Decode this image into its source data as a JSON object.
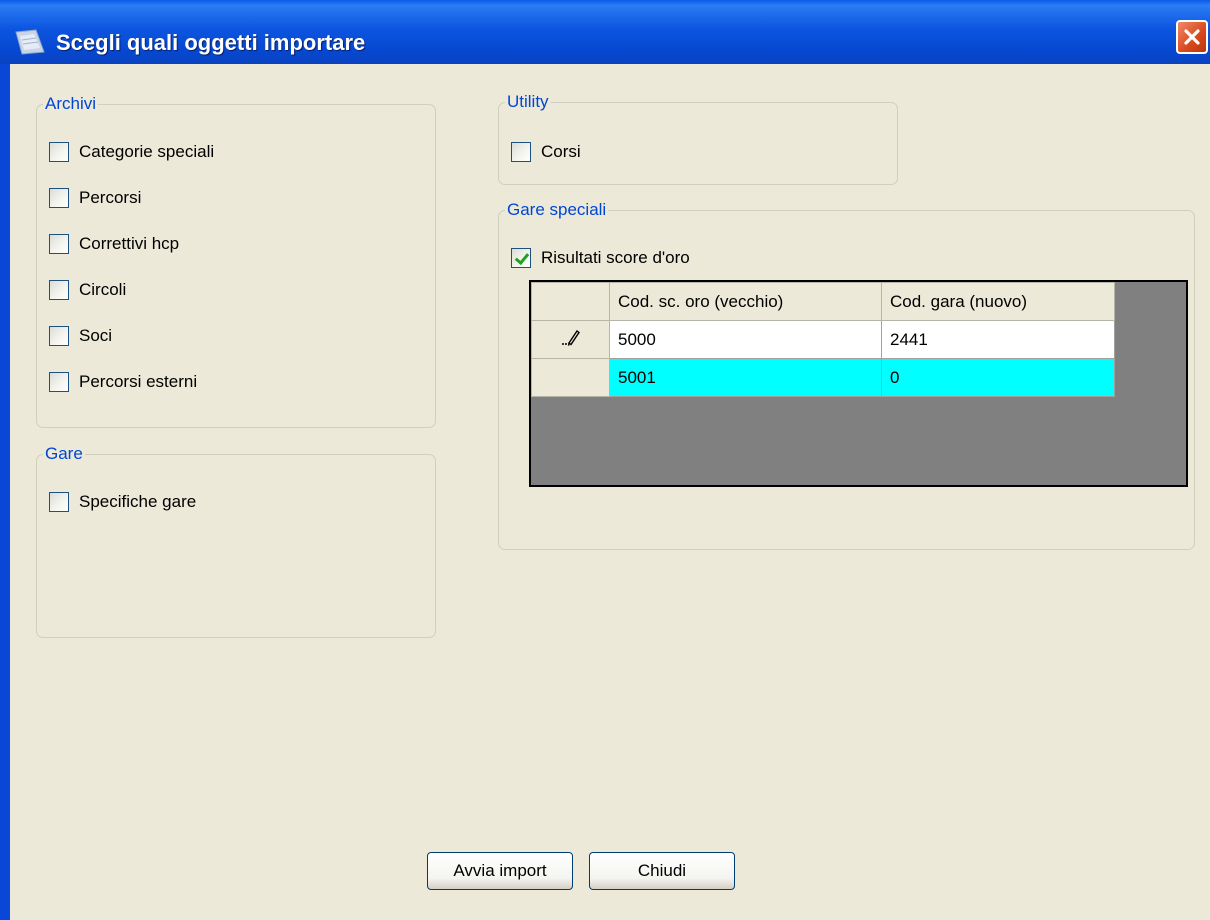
{
  "window": {
    "title": "Scegli quali oggetti importare"
  },
  "archivi": {
    "legend": "Archivi",
    "items": [
      {
        "label": "Categorie speciali",
        "checked": false
      },
      {
        "label": "Percorsi",
        "checked": false
      },
      {
        "label": "Correttivi hcp",
        "checked": false
      },
      {
        "label": "Circoli",
        "checked": false
      },
      {
        "label": "Soci",
        "checked": false
      },
      {
        "label": "Percorsi esterni",
        "checked": false
      }
    ]
  },
  "gare": {
    "legend": "Gare",
    "items": [
      {
        "label": "Specifiche gare",
        "checked": false
      }
    ]
  },
  "utility": {
    "legend": "Utility",
    "items": [
      {
        "label": "Corsi",
        "checked": false
      }
    ]
  },
  "gare_speciali": {
    "legend": "Gare speciali",
    "items": [
      {
        "label": "Risultati score d'oro",
        "checked": true
      }
    ],
    "grid": {
      "columns": [
        "Cod. sc. oro (vecchio)",
        "Cod. gara (nuovo)"
      ],
      "rows": [
        {
          "indicator": "pencil-icon",
          "cells": [
            "5000",
            "2441"
          ]
        },
        {
          "indicator": "",
          "cells": [
            "5001",
            "0"
          ]
        }
      ],
      "highlight_color": "#00ffff"
    }
  },
  "buttons": {
    "import_label": "Avvia import",
    "close_label": "Chiudi"
  },
  "colors": {
    "titlebar": "#0a5ae8",
    "legend": "#0046d5",
    "client": "#ece9d8"
  }
}
